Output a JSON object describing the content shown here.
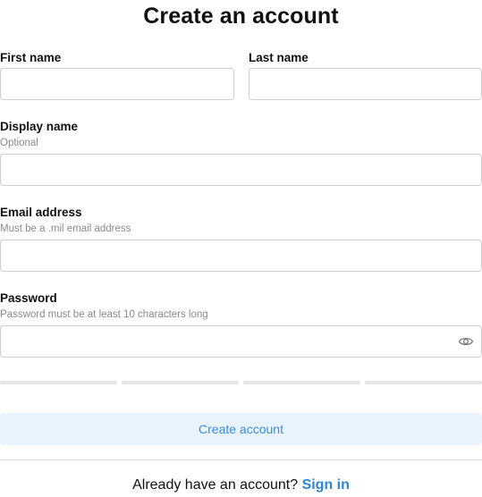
{
  "form": {
    "title": "Create an account",
    "first_name": {
      "label": "First name",
      "value": ""
    },
    "last_name": {
      "label": "Last name",
      "value": ""
    },
    "display_name": {
      "label": "Display name",
      "hint": "Optional",
      "value": ""
    },
    "email": {
      "label": "Email address",
      "hint": "Must be a .mil email address",
      "value": ""
    },
    "password": {
      "label": "Password",
      "hint": "Password must be at least 10 characters long",
      "value": "",
      "toggle_icon": "eye-icon"
    },
    "strength": {
      "segments": 4,
      "filled": 0
    },
    "submit_label": "Create account"
  },
  "footer": {
    "prompt": "Already have an account?",
    "link_label": "Sign in"
  },
  "colors": {
    "accent": "#2f86d4",
    "button_bg": "#e8f3fc",
    "border": "#cfcfcf",
    "hint": "#8a8a8a"
  }
}
